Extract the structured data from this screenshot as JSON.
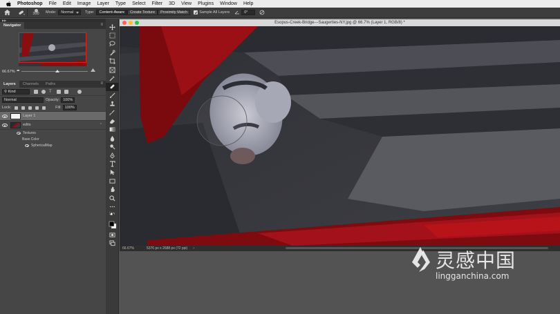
{
  "menubar": {
    "app": "Photoshop",
    "items": [
      "File",
      "Edit",
      "Image",
      "Layer",
      "Type",
      "Select",
      "Filter",
      "3D",
      "View",
      "Plugins",
      "Window",
      "Help"
    ]
  },
  "options": {
    "brush_size": "300",
    "mode_label": "Mode:",
    "mode_value": "Normal",
    "type_label": "Type:",
    "type_options": [
      "Content-Aware",
      "Create Texture",
      "Proximity Match"
    ],
    "sample_all_layers": "Sample All Layers",
    "angle_value": "0°"
  },
  "navigator": {
    "tab": "Navigator",
    "zoom": "66.67%"
  },
  "layers_panel": {
    "tabs": [
      "Layers",
      "Channels",
      "Paths"
    ],
    "kind": "Kind",
    "blend_mode": "Normal",
    "opacity_label": "Opacity:",
    "opacity_value": "100%",
    "lock_label": "Lock:",
    "fill_label": "Fill:",
    "fill_value": "100%",
    "layers": [
      {
        "name": "Layer 1"
      },
      {
        "name": "edits"
      }
    ],
    "effects": {
      "textures": "Textures",
      "base_color": "Base Color",
      "spherical_map": "SphericalMap"
    }
  },
  "document": {
    "title": "Esopus-Creek-Bridge---Saugerties-NY.jpg @ 66.7% (Layer 1, RGB/8) *",
    "zoom": "66.67%",
    "dimensions": "5376 px x 2688 px (72 ppi)"
  },
  "watermark": {
    "cn": "灵感中国",
    "en": "lingganchina.com"
  },
  "colors": {
    "accent_red": "#c8141a",
    "panel_bg": "#464646",
    "canvas_bg": "#3b3c41"
  }
}
